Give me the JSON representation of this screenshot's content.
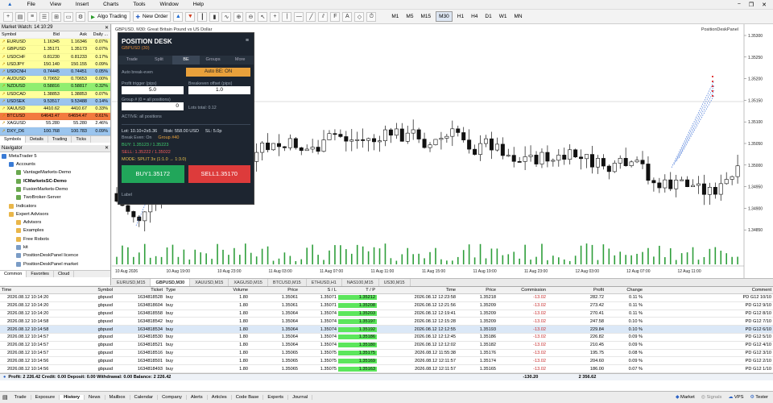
{
  "menu": [
    "File",
    "View",
    "Insert",
    "Charts",
    "Tools",
    "Window",
    "Help"
  ],
  "toolbar": {
    "algo_trading": "Algo Trading",
    "new_order": "New Order",
    "timeframes": [
      "M1",
      "M5",
      "M15",
      "M30",
      "H1",
      "H4",
      "D1",
      "W1",
      "MN"
    ],
    "active_tf": "M30"
  },
  "market_watch": {
    "title": "Market Watch: 14:10:29",
    "headers": [
      "Symbol",
      "Bid",
      "Ask",
      "Daily ..."
    ],
    "rows": [
      {
        "symbol": "EURUSD",
        "bid": "1.16345",
        "ask": "1.16346",
        "daily": "0.07%",
        "bg": "#ffff9c"
      },
      {
        "symbol": "GBPUSD",
        "bid": "1.35171",
        "ask": "1.35173",
        "daily": "0.07%",
        "bg": "#ffff9c"
      },
      {
        "symbol": "USDCHF",
        "bid": "0.81230",
        "ask": "0.81233",
        "daily": "0.17%",
        "bg": "#ffff9c"
      },
      {
        "symbol": "USDJPY",
        "bid": "150.140",
        "ask": "150.155",
        "daily": "0.09%",
        "bg": "#ffff9c"
      },
      {
        "symbol": "USDCNH",
        "bid": "0.74445",
        "ask": "0.74451",
        "daily": "0.05%",
        "bg": "#9bc5ee"
      },
      {
        "symbol": "AUDUSD",
        "bid": "0.70652",
        "ask": "0.70653",
        "daily": "0.00%",
        "bg": "#ffff9c"
      },
      {
        "symbol": "NZDUSD",
        "bid": "0.58816",
        "ask": "0.58817",
        "daily": "0.32%",
        "bg": "#90ee70"
      },
      {
        "symbol": "USDCAD",
        "bid": "1.38853",
        "ask": "1.38853",
        "daily": "0.07%",
        "bg": "#ffff9c"
      },
      {
        "symbol": "USDSEK",
        "bid": "9.53517",
        "ask": "9.53488",
        "daily": "0.14%",
        "bg": "#9bc5ee"
      },
      {
        "symbol": "XAUUSD",
        "bid": "4410.62",
        "ask": "4410.67",
        "daily": "0.33%",
        "bg": "#ffff9c"
      },
      {
        "symbol": "BTCUSD",
        "bid": "64643.47",
        "ask": "64654.47",
        "daily": "0.61%",
        "bg": "#f37a3f"
      },
      {
        "symbol": "XAGUSD",
        "bid": "55.280",
        "ask": "55.280",
        "daily": "2.46%",
        "bg": "#ffffff"
      },
      {
        "symbol": "DXY_D6",
        "bid": "100.768",
        "ask": "100.783",
        "daily": "0.09%",
        "bg": "#9bc5ee"
      }
    ],
    "tabs": [
      "Symbols",
      "Details",
      "Trading",
      "Ticks"
    ]
  },
  "navigator": {
    "title": "Navigator",
    "items": [
      {
        "label": "MetaTrader 5",
        "indent": 0,
        "bold": false,
        "icon": "#3a7bd5"
      },
      {
        "label": "Accounts",
        "indent": 1,
        "bold": false,
        "icon": "#3a7bd5"
      },
      {
        "label": "VantageMarkets-Demo",
        "indent": 2,
        "bold": false,
        "icon": "#6aa84f"
      },
      {
        "label": "ICMarketsSC-Demo",
        "indent": 2,
        "bold": true,
        "icon": "#6aa84f"
      },
      {
        "label": "FusionMarkets-Demo",
        "indent": 2,
        "bold": false,
        "icon": "#6aa84f"
      },
      {
        "label": "TwoBroker-Server",
        "indent": 2,
        "bold": false,
        "icon": "#6aa84f"
      },
      {
        "label": "Indicators",
        "indent": 1,
        "bold": false,
        "icon": "#e9b64a"
      },
      {
        "label": "Expert Advisors",
        "indent": 1,
        "bold": false,
        "icon": "#e9b64a"
      },
      {
        "label": "Advisors",
        "indent": 2,
        "bold": false,
        "icon": "#e9b64a"
      },
      {
        "label": "Examples",
        "indent": 2,
        "bold": false,
        "icon": "#e9b64a"
      },
      {
        "label": "Free Robots",
        "indent": 2,
        "bold": false,
        "icon": "#e9b64a"
      },
      {
        "label": "kit",
        "indent": 2,
        "bold": false,
        "icon": "#7a9cc6"
      },
      {
        "label": "PositionDeskPanel licence",
        "indent": 2,
        "bold": false,
        "icon": "#7a9cc6"
      },
      {
        "label": "PositionDeskPanel market",
        "indent": 2,
        "bold": false,
        "icon": "#7a9cc6"
      }
    ],
    "tabs": [
      "Common",
      "Favorites",
      "Cloud"
    ]
  },
  "chart": {
    "title": "GBPUSD, M30: Great Britain Pound vs US Dollar",
    "corner_label": "PositionDeskPanel",
    "price_labels": [
      "1.35300",
      "1.35250",
      "1.35200",
      "1.35150",
      "1.35100",
      "1.35050",
      "1.35000",
      "1.34950",
      "1.34900",
      "1.34850"
    ],
    "time_labels": [
      "10 Aug 2026",
      "10 Aug 19:00",
      "10 Aug 23:00",
      "11 Aug 03:00",
      "11 Aug 07:00",
      "11 Aug 11:00",
      "11 Aug 15:00",
      "11 Aug 19:00",
      "11 Aug 23:00",
      "12 Aug 03:00",
      "12 Aug 07:00",
      "12 Aug 11:00"
    ],
    "tabs": [
      "EURUSD,M15",
      "GBPUSD,M30",
      "XAUUSD,M15",
      "XAGUSD,M15",
      "BTCUSD,M15",
      "ETHUSD,H1",
      "NAS100,M15",
      "US30,M15"
    ],
    "active_tab": "GBPUSD,M30"
  },
  "position_desk": {
    "title": "POSITION DESK",
    "symbol": "GBPUSD (30)",
    "menu_icon": "≡",
    "tabs": [
      "Trade",
      "Split",
      "BE",
      "Groups",
      "More"
    ],
    "active_tab": "BE",
    "auto_be_label": "Auto break-even",
    "auto_be_button": "Auto BE: ON",
    "profit_trigger_label": "Profit trigger (pips)",
    "profit_trigger_value": "5.0",
    "be_offset_label": "Breakeven offset (pips)",
    "be_offset_value": "1.0",
    "group_label": "Group # (0 = all positions)",
    "group_value": "0",
    "lots_label": "Lots total: 0.12",
    "active_text": "ACTIVE: all positions",
    "lot_line": "Lot: 10.10+2x5.36",
    "risk_line": "Risk: 558.00 USD",
    "sl_line": "SL: 5.0p",
    "tp_line": "Break Even: On",
    "group_line": "Group #40",
    "buy_line": "BUY: 1.35123 / 1.35223",
    "sell_line": "SELL: 1.35222 / 1.35022",
    "mode_line": "MODE: SPLIT 3x (1:1.0 → 1:3.0)",
    "buy_button": "BUY1.35172",
    "sell_button": "SELL1.35170",
    "footer_label": "Label"
  },
  "trades": {
    "headers": [
      "Time",
      "Symbol",
      "Ticket",
      "Type",
      "Volume",
      "Price",
      "S / L",
      "T / P",
      "Time",
      "Price",
      "Commission",
      "Profit",
      "Change",
      "Comment"
    ],
    "rows": [
      [
        "2026.08.12 10:14:20",
        "gbpusd",
        "1634818528",
        "buy",
        "1.80",
        "1.35061",
        "1.35071",
        "1.35212",
        "2026.08.12 12:23:58",
        "1.35218",
        "-13.02",
        "282.72",
        "0.11 %",
        "PD G12 10/10"
      ],
      [
        "2026.08.12 10:14:20",
        "gbpusd",
        "1634818604",
        "buy",
        "1.80",
        "1.35061",
        "1.35071",
        "1.35208",
        "2026.08.12 12:21:56",
        "1.35209",
        "-13.02",
        "273.42",
        "0.11 %",
        "PD G12 9/10"
      ],
      [
        "2026.08.12 10:14:20",
        "gbpusd",
        "1634818558",
        "buy",
        "1.80",
        "1.35064",
        "1.35074",
        "1.35203",
        "2026.08.12 12:19:41",
        "1.35209",
        "-13.02",
        "270.41",
        "0.11 %",
        "PD G12 8/10"
      ],
      [
        "2026.08.12 10:14:58",
        "gbpusd",
        "1634818542",
        "buy",
        "1.80",
        "1.35064",
        "1.35074",
        "1.35197",
        "2026.08.12 12:15:28",
        "1.35209",
        "-13.02",
        "247.58",
        "0.10 %",
        "PD G12 7/10"
      ],
      [
        "2026.08.12 10:14:58",
        "gbpusd",
        "1634818534",
        "buy",
        "1.80",
        "1.35064",
        "1.35074",
        "1.35192",
        "2026.08.12 12:12:55",
        "1.35193",
        "-13.02",
        "229.84",
        "0.10 %",
        "PD G12 6/10"
      ],
      [
        "2026.08.12 10:14:57",
        "gbpusd",
        "1634818530",
        "buy",
        "1.80",
        "1.35064",
        "1.35074",
        "1.35186",
        "2026.08.12 12:12:45",
        "1.35186",
        "-13.02",
        "226.82",
        "0.09 %",
        "PD G12 5/10"
      ],
      [
        "2026.08.12 10:14:57",
        "gbpusd",
        "1634818521",
        "buy",
        "1.80",
        "1.35064",
        "1.35074",
        "1.35180",
        "2026.08.12 12:12:02",
        "1.35182",
        "-13.02",
        "210.45",
        "0.09 %",
        "PD G12 4/10"
      ],
      [
        "2026.08.12 10:14:57",
        "gbpusd",
        "1634818516",
        "buy",
        "1.80",
        "1.35065",
        "1.35075",
        "1.35175",
        "2026.08.12 11:55:38",
        "1.35176",
        "-13.02",
        "195.75",
        "0.08 %",
        "PD G12 3/10"
      ],
      [
        "2026.08.12 10:14:56",
        "gbpusd",
        "1634818501",
        "buy",
        "1.80",
        "1.35065",
        "1.35075",
        "1.35169",
        "2026.08.12 12:11:57",
        "1.35174",
        "-13.02",
        "204.60",
        "0.09 %",
        "PD G12 2/10"
      ],
      [
        "2026.08.12 10:14:56",
        "gbpusd",
        "1634818493",
        "buy",
        "1.80",
        "1.35065",
        "1.35075",
        "1.35163",
        "2026.08.12 12:11:57",
        "1.35165",
        "-13.02",
        "186.00",
        "0.07 %",
        "PD G12 1/10"
      ]
    ],
    "highlight_row": 4,
    "summary": "Profit: 2 226.42  Credit: 0.00  Deposit: 0.00  Withdrawal: 0.00  Balance: 2 226.42",
    "summary_commission": "-130.20",
    "summary_profit": "2 356.62"
  },
  "bottom_tabs": [
    "Trade",
    "Exposure",
    "History",
    "News",
    "Mailbox",
    "Calendar",
    "Company",
    "Alerts",
    "Articles",
    "Code Base",
    "Experts",
    "Journal"
  ],
  "active_bottom_tab": "History",
  "status": {
    "market": "Market",
    "signals": "Signals",
    "vps": "VPS",
    "tester": "Tester"
  },
  "colors": {
    "tp_green": "#5ce65c",
    "buy_button": "#21a65a",
    "sell_button": "#dd3b3b",
    "auto_be": "#e9a13b",
    "bear_candle": "#111111",
    "bull_candle": "#ffffff",
    "volume": "#2e9e3a"
  }
}
